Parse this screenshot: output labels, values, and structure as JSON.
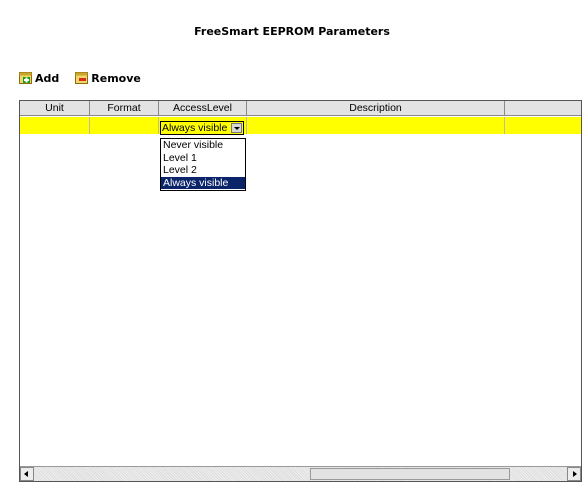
{
  "title": "FreeSmart EEPROM Parameters",
  "toolbar": {
    "add_label": "Add",
    "remove_label": "Remove"
  },
  "table": {
    "columns": [
      "Unit",
      "Format",
      "AccessLevel",
      "Description",
      ""
    ],
    "row": {
      "unit": "",
      "format": "",
      "access_level": "Always visible",
      "description": ""
    }
  },
  "dropdown": {
    "selected": "Always visible",
    "options": [
      "Never visible",
      "Level 1",
      "Level 2",
      "Always visible"
    ]
  },
  "colors": {
    "row_highlight": "#ffff00",
    "header_bg": "#e3e3e3",
    "selection_bg": "#0a246a"
  }
}
